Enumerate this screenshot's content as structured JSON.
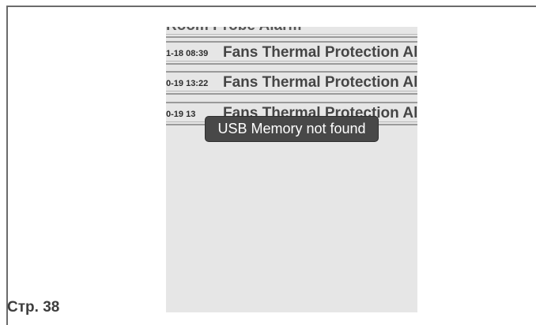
{
  "screen": {
    "clipped_top_text": "Room Probe Alarm",
    "alarms": [
      {
        "time": "1-18 08:39",
        "text": "Fans Thermal Protection Al"
      },
      {
        "time": "0-19 13:22",
        "text": "Fans Thermal Protection Al"
      },
      {
        "time": "0-19 13",
        "text": "Fans Thermal Protection Al"
      }
    ]
  },
  "toast": {
    "message": "USB Memory not found"
  },
  "page": {
    "number_label": "Стр. 38"
  }
}
